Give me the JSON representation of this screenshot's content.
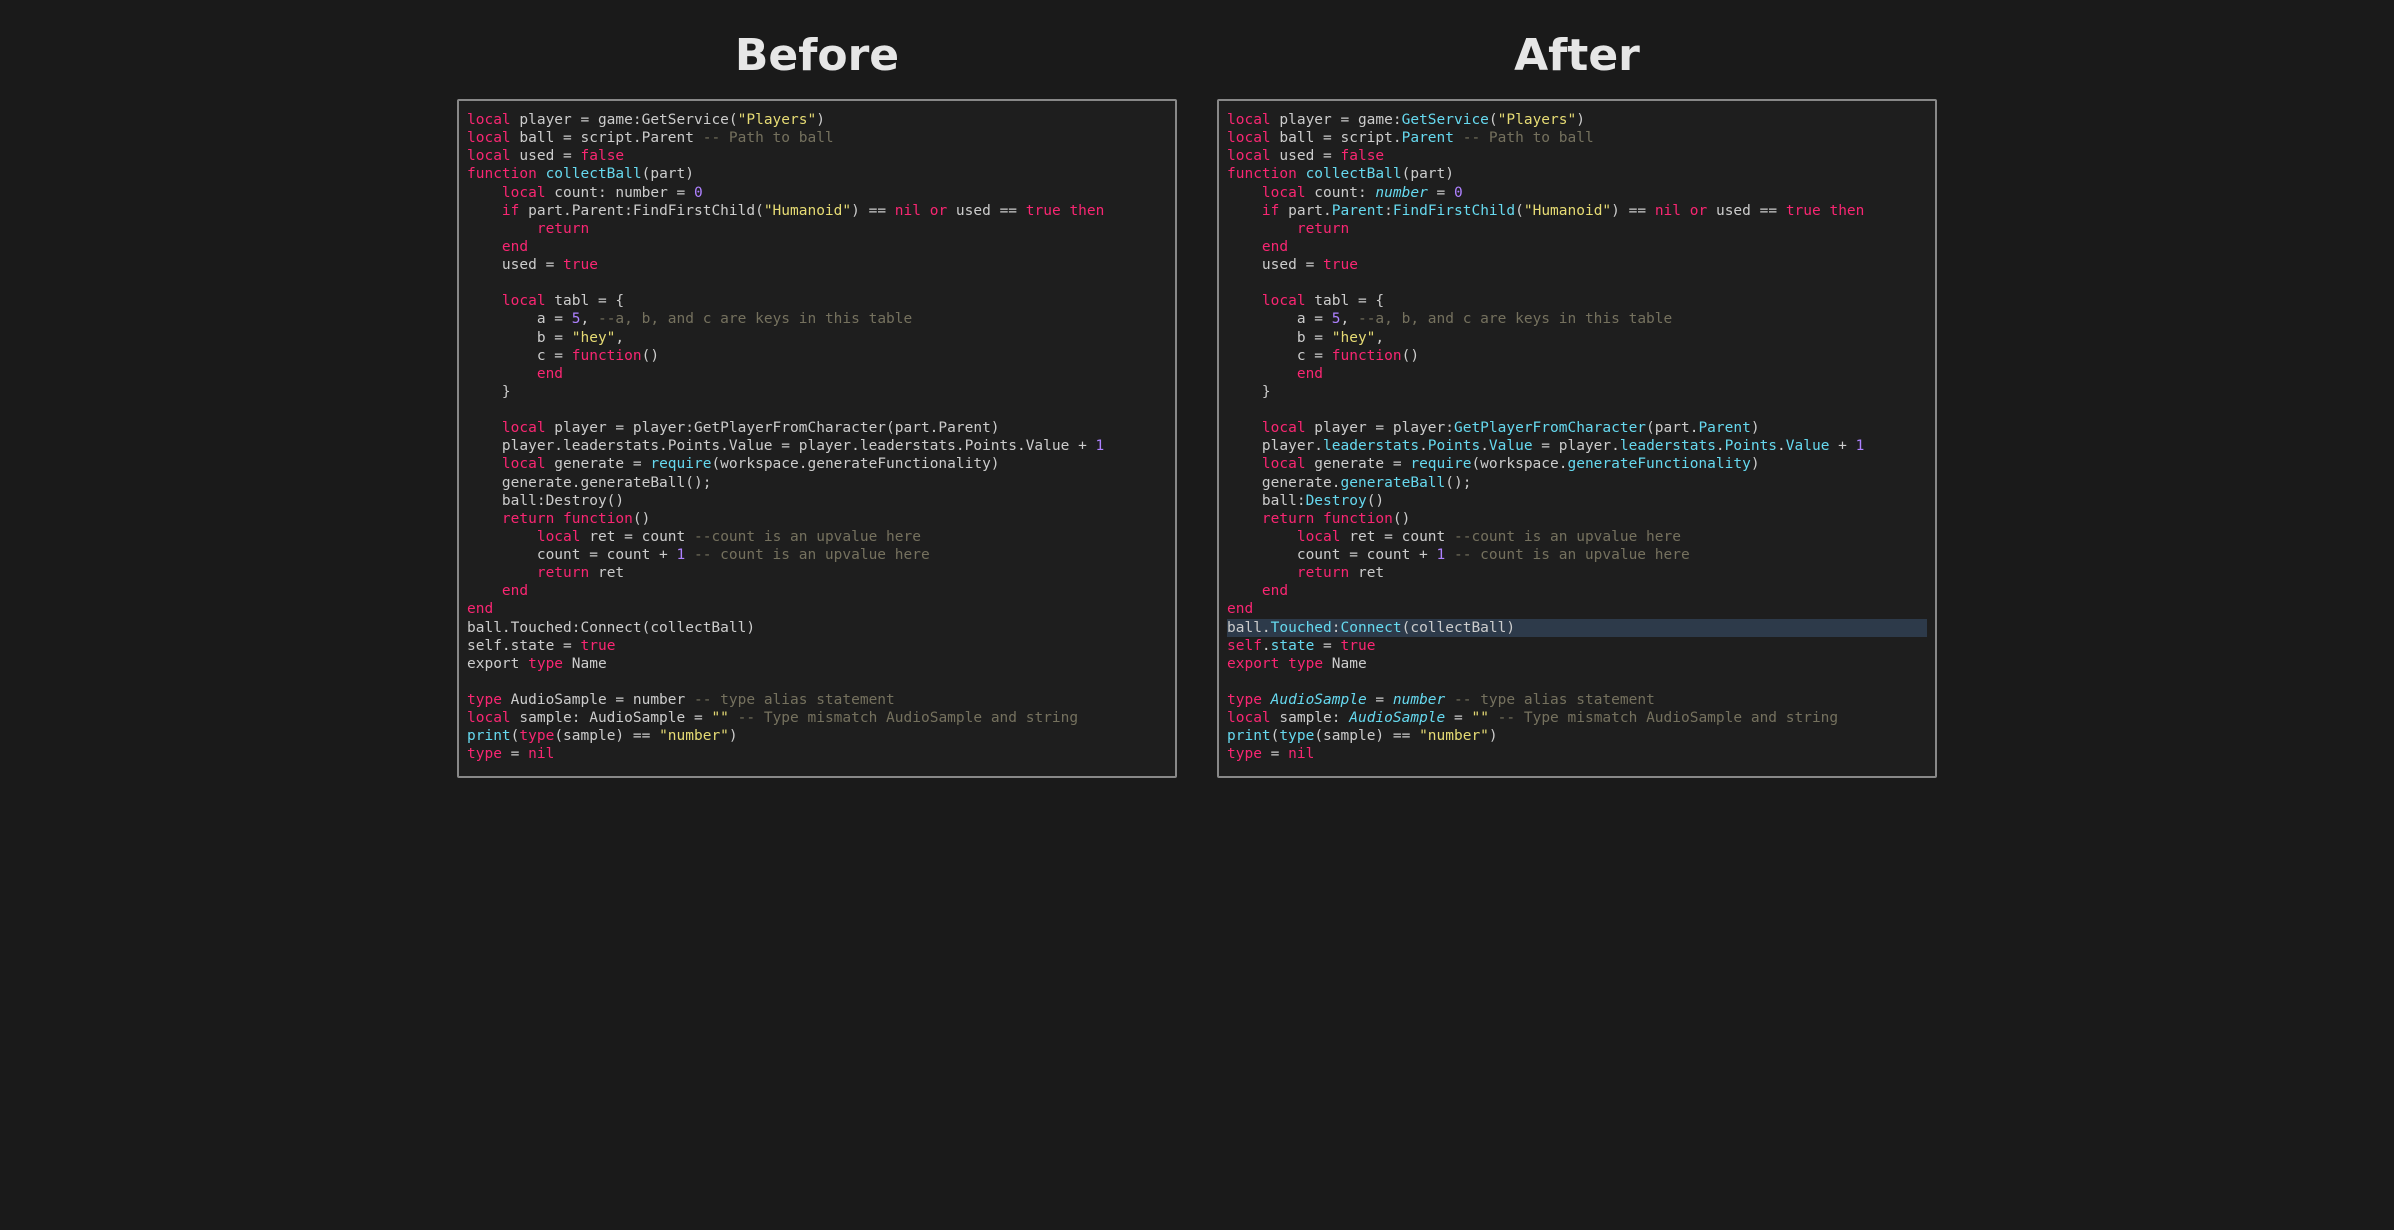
{
  "labels": {
    "before": "Before",
    "after": "After"
  },
  "colors": {
    "background": "#1a1a1a",
    "codebg": "#1e1e1e",
    "border": "#888888",
    "keyword": "#F92672",
    "function": "#66D9EF",
    "number": "#AE81FF",
    "string": "#E6DB74",
    "comment": "#75715E",
    "default": "#cccccc",
    "highlight_line": "#2d3a4a"
  },
  "code_before": [
    [
      {
        "t": "kw",
        "v": "local"
      },
      {
        "t": "plain",
        "v": " player = game:GetService("
      },
      {
        "t": "str",
        "v": "\"Players\""
      },
      {
        "t": "plain",
        "v": ")"
      }
    ],
    [
      {
        "t": "kw",
        "v": "local"
      },
      {
        "t": "plain",
        "v": " ball = script.Parent "
      },
      {
        "t": "com",
        "v": "-- Path to ball"
      }
    ],
    [
      {
        "t": "kw",
        "v": "local"
      },
      {
        "t": "plain",
        "v": " used = "
      },
      {
        "t": "bool",
        "v": "false"
      }
    ],
    [
      {
        "t": "kw",
        "v": "function"
      },
      {
        "t": "plain",
        "v": " "
      },
      {
        "t": "func",
        "v": "collectBall"
      },
      {
        "t": "plain",
        "v": "(part)"
      }
    ],
    [
      {
        "t": "plain",
        "v": "    "
      },
      {
        "t": "kw",
        "v": "local"
      },
      {
        "t": "plain",
        "v": " count: number = "
      },
      {
        "t": "num",
        "v": "0"
      }
    ],
    [
      {
        "t": "plain",
        "v": "    "
      },
      {
        "t": "kw",
        "v": "if"
      },
      {
        "t": "plain",
        "v": " part.Parent:FindFirstChild("
      },
      {
        "t": "str",
        "v": "\"Humanoid\""
      },
      {
        "t": "plain",
        "v": ") == "
      },
      {
        "t": "bool",
        "v": "nil"
      },
      {
        "t": "plain",
        "v": " "
      },
      {
        "t": "kw",
        "v": "or"
      },
      {
        "t": "plain",
        "v": " used == "
      },
      {
        "t": "bool",
        "v": "true"
      },
      {
        "t": "plain",
        "v": " "
      },
      {
        "t": "kw",
        "v": "then"
      }
    ],
    [
      {
        "t": "plain",
        "v": "        "
      },
      {
        "t": "kw",
        "v": "return"
      }
    ],
    [
      {
        "t": "plain",
        "v": "    "
      },
      {
        "t": "kw",
        "v": "end"
      }
    ],
    [
      {
        "t": "plain",
        "v": "    used = "
      },
      {
        "t": "bool",
        "v": "true"
      }
    ],
    [],
    [
      {
        "t": "plain",
        "v": "    "
      },
      {
        "t": "kw",
        "v": "local"
      },
      {
        "t": "plain",
        "v": " tabl = {"
      }
    ],
    [
      {
        "t": "plain",
        "v": "        a = "
      },
      {
        "t": "num",
        "v": "5"
      },
      {
        "t": "plain",
        "v": ", "
      },
      {
        "t": "com",
        "v": "--a, b, and c are keys in this table"
      }
    ],
    [
      {
        "t": "plain",
        "v": "        b = "
      },
      {
        "t": "str",
        "v": "\"hey\""
      },
      {
        "t": "plain",
        "v": ","
      }
    ],
    [
      {
        "t": "plain",
        "v": "        c = "
      },
      {
        "t": "kw",
        "v": "function"
      },
      {
        "t": "plain",
        "v": "()"
      }
    ],
    [
      {
        "t": "plain",
        "v": "        "
      },
      {
        "t": "kw",
        "v": "end"
      }
    ],
    [
      {
        "t": "plain",
        "v": "    }"
      }
    ],
    [],
    [
      {
        "t": "plain",
        "v": "    "
      },
      {
        "t": "kw",
        "v": "local"
      },
      {
        "t": "plain",
        "v": " player = player:GetPlayerFromCharacter(part.Parent)"
      }
    ],
    [
      {
        "t": "plain",
        "v": "    player.leaderstats.Points.Value = player.leaderstats.Points.Value + "
      },
      {
        "t": "num",
        "v": "1"
      }
    ],
    [
      {
        "t": "plain",
        "v": "    "
      },
      {
        "t": "kw",
        "v": "local"
      },
      {
        "t": "plain",
        "v": " generate = "
      },
      {
        "t": "func",
        "v": "require"
      },
      {
        "t": "plain",
        "v": "(workspace.generateFunctionality)"
      }
    ],
    [
      {
        "t": "plain",
        "v": "    generate.generateBall();"
      }
    ],
    [
      {
        "t": "plain",
        "v": "    ball:Destroy()"
      }
    ],
    [
      {
        "t": "plain",
        "v": "    "
      },
      {
        "t": "kw",
        "v": "return"
      },
      {
        "t": "plain",
        "v": " "
      },
      {
        "t": "kw",
        "v": "function"
      },
      {
        "t": "plain",
        "v": "()"
      }
    ],
    [
      {
        "t": "plain",
        "v": "        "
      },
      {
        "t": "kw",
        "v": "local"
      },
      {
        "t": "plain",
        "v": " ret = count "
      },
      {
        "t": "com",
        "v": "--count is an upvalue here"
      }
    ],
    [
      {
        "t": "plain",
        "v": "        count = count + "
      },
      {
        "t": "num",
        "v": "1"
      },
      {
        "t": "plain",
        "v": " "
      },
      {
        "t": "com",
        "v": "-- count is an upvalue here"
      }
    ],
    [
      {
        "t": "plain",
        "v": "        "
      },
      {
        "t": "kw",
        "v": "return"
      },
      {
        "t": "plain",
        "v": " ret"
      }
    ],
    [
      {
        "t": "plain",
        "v": "    "
      },
      {
        "t": "kw",
        "v": "end"
      }
    ],
    [
      {
        "t": "kw",
        "v": "end"
      }
    ],
    [
      {
        "t": "plain",
        "v": "ball.Touched:Connect(collectBall)"
      }
    ],
    [
      {
        "t": "plain",
        "v": "self.state = "
      },
      {
        "t": "bool",
        "v": "true"
      }
    ],
    [
      {
        "t": "plain",
        "v": "export "
      },
      {
        "t": "kw",
        "v": "type"
      },
      {
        "t": "plain",
        "v": " Name"
      }
    ],
    [],
    [
      {
        "t": "kw",
        "v": "type"
      },
      {
        "t": "plain",
        "v": " AudioSample = number "
      },
      {
        "t": "com",
        "v": "-- type alias statement"
      }
    ],
    [
      {
        "t": "kw",
        "v": "local"
      },
      {
        "t": "plain",
        "v": " sample: AudioSample = "
      },
      {
        "t": "str",
        "v": "\"\""
      },
      {
        "t": "plain",
        "v": " "
      },
      {
        "t": "com",
        "v": "-- Type mismatch AudioSample and string"
      }
    ],
    [
      {
        "t": "func",
        "v": "print"
      },
      {
        "t": "plain",
        "v": "("
      },
      {
        "t": "kw",
        "v": "type"
      },
      {
        "t": "plain",
        "v": "(sample) == "
      },
      {
        "t": "str",
        "v": "\"number\""
      },
      {
        "t": "plain",
        "v": ")"
      }
    ],
    [
      {
        "t": "kw",
        "v": "type"
      },
      {
        "t": "plain",
        "v": " = "
      },
      {
        "t": "bool",
        "v": "nil"
      }
    ]
  ],
  "code_after": [
    [
      {
        "t": "kw",
        "v": "local"
      },
      {
        "t": "plain",
        "v": " player = game:"
      },
      {
        "t": "func",
        "v": "GetService"
      },
      {
        "t": "plain",
        "v": "("
      },
      {
        "t": "str",
        "v": "\"Players\""
      },
      {
        "t": "plain",
        "v": ")"
      }
    ],
    [
      {
        "t": "kw",
        "v": "local"
      },
      {
        "t": "plain",
        "v": " ball = script."
      },
      {
        "t": "prop",
        "v": "Parent"
      },
      {
        "t": "plain",
        "v": " "
      },
      {
        "t": "com",
        "v": "-- Path to ball"
      }
    ],
    [
      {
        "t": "kw",
        "v": "local"
      },
      {
        "t": "plain",
        "v": " used = "
      },
      {
        "t": "bool",
        "v": "false"
      }
    ],
    [
      {
        "t": "kw",
        "v": "function"
      },
      {
        "t": "plain",
        "v": " "
      },
      {
        "t": "func",
        "v": "collectBall"
      },
      {
        "t": "plain",
        "v": "(part)"
      }
    ],
    [
      {
        "t": "plain",
        "v": "    "
      },
      {
        "t": "kw",
        "v": "local"
      },
      {
        "t": "plain",
        "v": " count: "
      },
      {
        "t": "type",
        "v": "number"
      },
      {
        "t": "plain",
        "v": " = "
      },
      {
        "t": "num",
        "v": "0"
      }
    ],
    [
      {
        "t": "plain",
        "v": "    "
      },
      {
        "t": "kw",
        "v": "if"
      },
      {
        "t": "plain",
        "v": " part."
      },
      {
        "t": "prop",
        "v": "Parent"
      },
      {
        "t": "plain",
        "v": ":"
      },
      {
        "t": "func",
        "v": "FindFirstChild"
      },
      {
        "t": "plain",
        "v": "("
      },
      {
        "t": "str",
        "v": "\"Humanoid\""
      },
      {
        "t": "plain",
        "v": ") == "
      },
      {
        "t": "bool",
        "v": "nil"
      },
      {
        "t": "plain",
        "v": " "
      },
      {
        "t": "kw",
        "v": "or"
      },
      {
        "t": "plain",
        "v": " used == "
      },
      {
        "t": "bool",
        "v": "true"
      },
      {
        "t": "plain",
        "v": " "
      },
      {
        "t": "kw",
        "v": "then"
      }
    ],
    [
      {
        "t": "plain",
        "v": "        "
      },
      {
        "t": "kw",
        "v": "return"
      }
    ],
    [
      {
        "t": "plain",
        "v": "    "
      },
      {
        "t": "kw",
        "v": "end"
      }
    ],
    [
      {
        "t": "plain",
        "v": "    used = "
      },
      {
        "t": "bool",
        "v": "true"
      }
    ],
    [],
    [
      {
        "t": "plain",
        "v": "    "
      },
      {
        "t": "kw",
        "v": "local"
      },
      {
        "t": "plain",
        "v": " tabl = {"
      }
    ],
    [
      {
        "t": "plain",
        "v": "        a = "
      },
      {
        "t": "num",
        "v": "5"
      },
      {
        "t": "plain",
        "v": ", "
      },
      {
        "t": "com",
        "v": "--a, b, and c are keys in this table"
      }
    ],
    [
      {
        "t": "plain",
        "v": "        b = "
      },
      {
        "t": "str",
        "v": "\"hey\""
      },
      {
        "t": "plain",
        "v": ","
      }
    ],
    [
      {
        "t": "plain",
        "v": "        c = "
      },
      {
        "t": "kw",
        "v": "function"
      },
      {
        "t": "plain",
        "v": "()"
      }
    ],
    [
      {
        "t": "plain",
        "v": "        "
      },
      {
        "t": "kw",
        "v": "end"
      }
    ],
    [
      {
        "t": "plain",
        "v": "    }"
      }
    ],
    [],
    [
      {
        "t": "plain",
        "v": "    "
      },
      {
        "t": "kw",
        "v": "local"
      },
      {
        "t": "plain",
        "v": " player = player:"
      },
      {
        "t": "func",
        "v": "GetPlayerFromCharacter"
      },
      {
        "t": "plain",
        "v": "(part."
      },
      {
        "t": "prop",
        "v": "Parent"
      },
      {
        "t": "plain",
        "v": ")"
      }
    ],
    [
      {
        "t": "plain",
        "v": "    player."
      },
      {
        "t": "prop",
        "v": "leaderstats"
      },
      {
        "t": "plain",
        "v": "."
      },
      {
        "t": "prop",
        "v": "Points"
      },
      {
        "t": "plain",
        "v": "."
      },
      {
        "t": "prop",
        "v": "Value"
      },
      {
        "t": "plain",
        "v": " = player."
      },
      {
        "t": "prop",
        "v": "leaderstats"
      },
      {
        "t": "plain",
        "v": "."
      },
      {
        "t": "prop",
        "v": "Points"
      },
      {
        "t": "plain",
        "v": "."
      },
      {
        "t": "prop",
        "v": "Value"
      },
      {
        "t": "plain",
        "v": " + "
      },
      {
        "t": "num",
        "v": "1"
      }
    ],
    [
      {
        "t": "plain",
        "v": "    "
      },
      {
        "t": "kw",
        "v": "local"
      },
      {
        "t": "plain",
        "v": " generate = "
      },
      {
        "t": "func",
        "v": "require"
      },
      {
        "t": "plain",
        "v": "(workspace."
      },
      {
        "t": "prop",
        "v": "generateFunctionality"
      },
      {
        "t": "plain",
        "v": ")"
      }
    ],
    [
      {
        "t": "plain",
        "v": "    generate."
      },
      {
        "t": "func",
        "v": "generateBall"
      },
      {
        "t": "plain",
        "v": "();"
      }
    ],
    [
      {
        "t": "plain",
        "v": "    ball:"
      },
      {
        "t": "func",
        "v": "Destroy"
      },
      {
        "t": "plain",
        "v": "()"
      }
    ],
    [
      {
        "t": "plain",
        "v": "    "
      },
      {
        "t": "kw",
        "v": "return"
      },
      {
        "t": "plain",
        "v": " "
      },
      {
        "t": "kw",
        "v": "function"
      },
      {
        "t": "plain",
        "v": "()"
      }
    ],
    [
      {
        "t": "plain",
        "v": "        "
      },
      {
        "t": "kw",
        "v": "local"
      },
      {
        "t": "plain",
        "v": " ret = count "
      },
      {
        "t": "com",
        "v": "--count is an upvalue here"
      }
    ],
    [
      {
        "t": "plain",
        "v": "        count = count + "
      },
      {
        "t": "num",
        "v": "1"
      },
      {
        "t": "plain",
        "v": " "
      },
      {
        "t": "com",
        "v": "-- count is an upvalue here"
      }
    ],
    [
      {
        "t": "plain",
        "v": "        "
      },
      {
        "t": "kw",
        "v": "return"
      },
      {
        "t": "plain",
        "v": " ret"
      }
    ],
    [
      {
        "t": "plain",
        "v": "    "
      },
      {
        "t": "kw",
        "v": "end"
      }
    ],
    [
      {
        "t": "kw",
        "v": "end"
      }
    ],
    [
      {
        "t": "plain",
        "v": "ball."
      },
      {
        "t": "prop",
        "v": "Touched"
      },
      {
        "t": "plain",
        "v": ":"
      },
      {
        "t": "func",
        "v": "Connect"
      },
      {
        "t": "plain",
        "v": "(collectBall)"
      }
    ],
    [
      {
        "t": "kw",
        "v": "self"
      },
      {
        "t": "plain",
        "v": "."
      },
      {
        "t": "prop",
        "v": "state"
      },
      {
        "t": "plain",
        "v": " = "
      },
      {
        "t": "bool",
        "v": "true"
      }
    ],
    [
      {
        "t": "kw",
        "v": "export"
      },
      {
        "t": "plain",
        "v": " "
      },
      {
        "t": "kw",
        "v": "type"
      },
      {
        "t": "plain",
        "v": " Name"
      }
    ],
    [],
    [
      {
        "t": "kw",
        "v": "type"
      },
      {
        "t": "plain",
        "v": " "
      },
      {
        "t": "type",
        "v": "AudioSample"
      },
      {
        "t": "plain",
        "v": " = "
      },
      {
        "t": "type",
        "v": "number"
      },
      {
        "t": "plain",
        "v": " "
      },
      {
        "t": "com",
        "v": "-- type alias statement"
      }
    ],
    [
      {
        "t": "kw",
        "v": "local"
      },
      {
        "t": "plain",
        "v": " sample: "
      },
      {
        "t": "type",
        "v": "AudioSample"
      },
      {
        "t": "plain",
        "v": " = "
      },
      {
        "t": "str",
        "v": "\"\""
      },
      {
        "t": "plain",
        "v": " "
      },
      {
        "t": "com",
        "v": "-- Type mismatch AudioSample and string"
      }
    ],
    [
      {
        "t": "func",
        "v": "print"
      },
      {
        "t": "plain",
        "v": "("
      },
      {
        "t": "func",
        "v": "type"
      },
      {
        "t": "plain",
        "v": "(sample) == "
      },
      {
        "t": "str",
        "v": "\"number\""
      },
      {
        "t": "plain",
        "v": ")"
      }
    ],
    [
      {
        "t": "kw",
        "v": "type"
      },
      {
        "t": "plain",
        "v": " = "
      },
      {
        "t": "bool",
        "v": "nil"
      }
    ]
  ],
  "after_highlight_line_index": 28
}
